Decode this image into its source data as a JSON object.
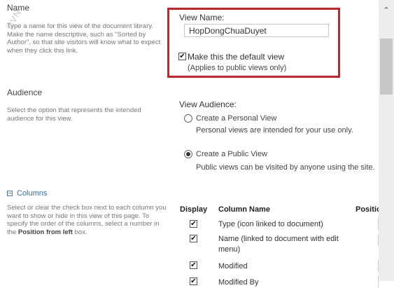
{
  "name_section": {
    "title": "Name",
    "description": "Type a name for this view of the document library. Make the name descriptive, such as \"Sorted by Author\", so that site visitors will know what to expect when they click this link.",
    "view_name_label": "View Name:",
    "view_name_value": "HopDongChuaDuyet",
    "default_view_label": "Make this the default view",
    "default_view_checked": true,
    "default_view_note": "(Applies to public views only)"
  },
  "audience_section": {
    "title": "Audience",
    "description": "Select the option that represents the intended audience for this view.",
    "view_audience_label": "View Audience:",
    "personal_label": "Create a Personal View",
    "personal_desc": "Personal views are intended for your use only.",
    "public_label": "Create a Public View",
    "public_desc": "Public views can be visited by anyone using the site.",
    "selected": "public"
  },
  "columns_section": {
    "title": "Columns",
    "collapse_glyph": "−",
    "description_part1": "Select or clear the check box next to each column you want to show or hide in this view of this page. To specify the order of the columns, select a number in the ",
    "description_bold": "Position from left",
    "description_part2": " box.",
    "headers": {
      "display": "Display",
      "column_name": "Column Name",
      "position": "Position"
    },
    "rows": [
      {
        "checked": true,
        "name": "Type (icon linked to document)"
      },
      {
        "checked": true,
        "name": "Name (linked to document with edit menu)"
      },
      {
        "checked": true,
        "name": "Modified"
      },
      {
        "checked": true,
        "name": "Modified By"
      }
    ]
  },
  "watermark": "©VN",
  "icons": {
    "scroll_up": "chevron-up-icon",
    "check": "checkmark-icon",
    "collapse": "minus-box-icon"
  },
  "colors": {
    "highlight": "#d11f2a",
    "link": "#2d6fb8"
  }
}
